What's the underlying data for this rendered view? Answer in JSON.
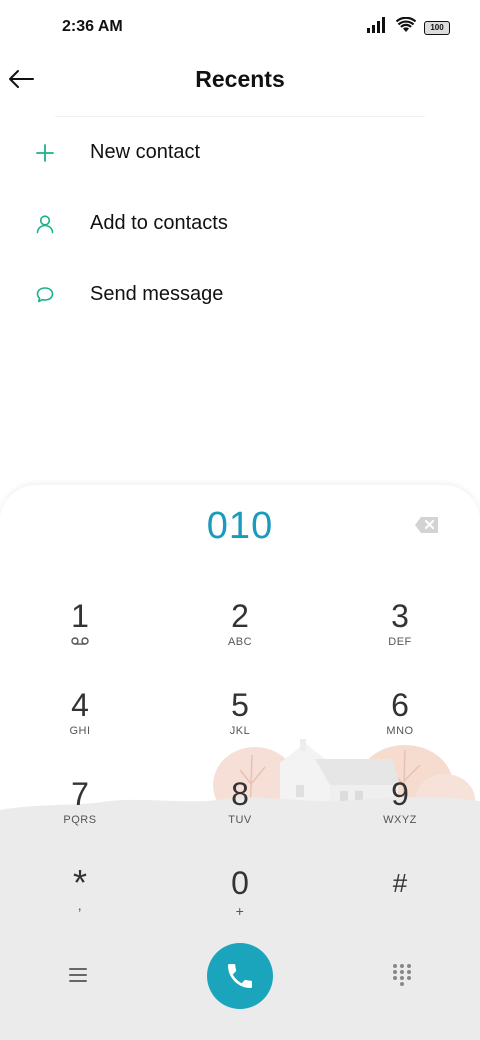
{
  "status_bar": {
    "time": "2:36 AM",
    "battery": "100"
  },
  "header": {
    "title": "Recents"
  },
  "menu": {
    "items": [
      {
        "label": "New contact",
        "icon": "plus-icon"
      },
      {
        "label": "Add to contacts",
        "icon": "person-icon"
      },
      {
        "label": "Send message",
        "icon": "chat-bubble-icon"
      }
    ]
  },
  "dialer": {
    "number": "010",
    "keys": [
      {
        "digit": "1",
        "sub": "voicemail-icon"
      },
      {
        "digit": "2",
        "sub": "ABC"
      },
      {
        "digit": "3",
        "sub": "DEF"
      },
      {
        "digit": "4",
        "sub": "GHI"
      },
      {
        "digit": "5",
        "sub": "JKL"
      },
      {
        "digit": "6",
        "sub": "MNO"
      },
      {
        "digit": "7",
        "sub": "PQRS"
      },
      {
        "digit": "8",
        "sub": "TUV"
      },
      {
        "digit": "9",
        "sub": "WXYZ"
      },
      {
        "digit": "*",
        "sub": ","
      },
      {
        "digit": "0",
        "sub": "+"
      },
      {
        "digit": "#",
        "sub": ""
      }
    ]
  },
  "colors": {
    "accent": "#1ba5bd",
    "number_text": "#1a9bbd",
    "menu_icon": "#1cb08a"
  }
}
